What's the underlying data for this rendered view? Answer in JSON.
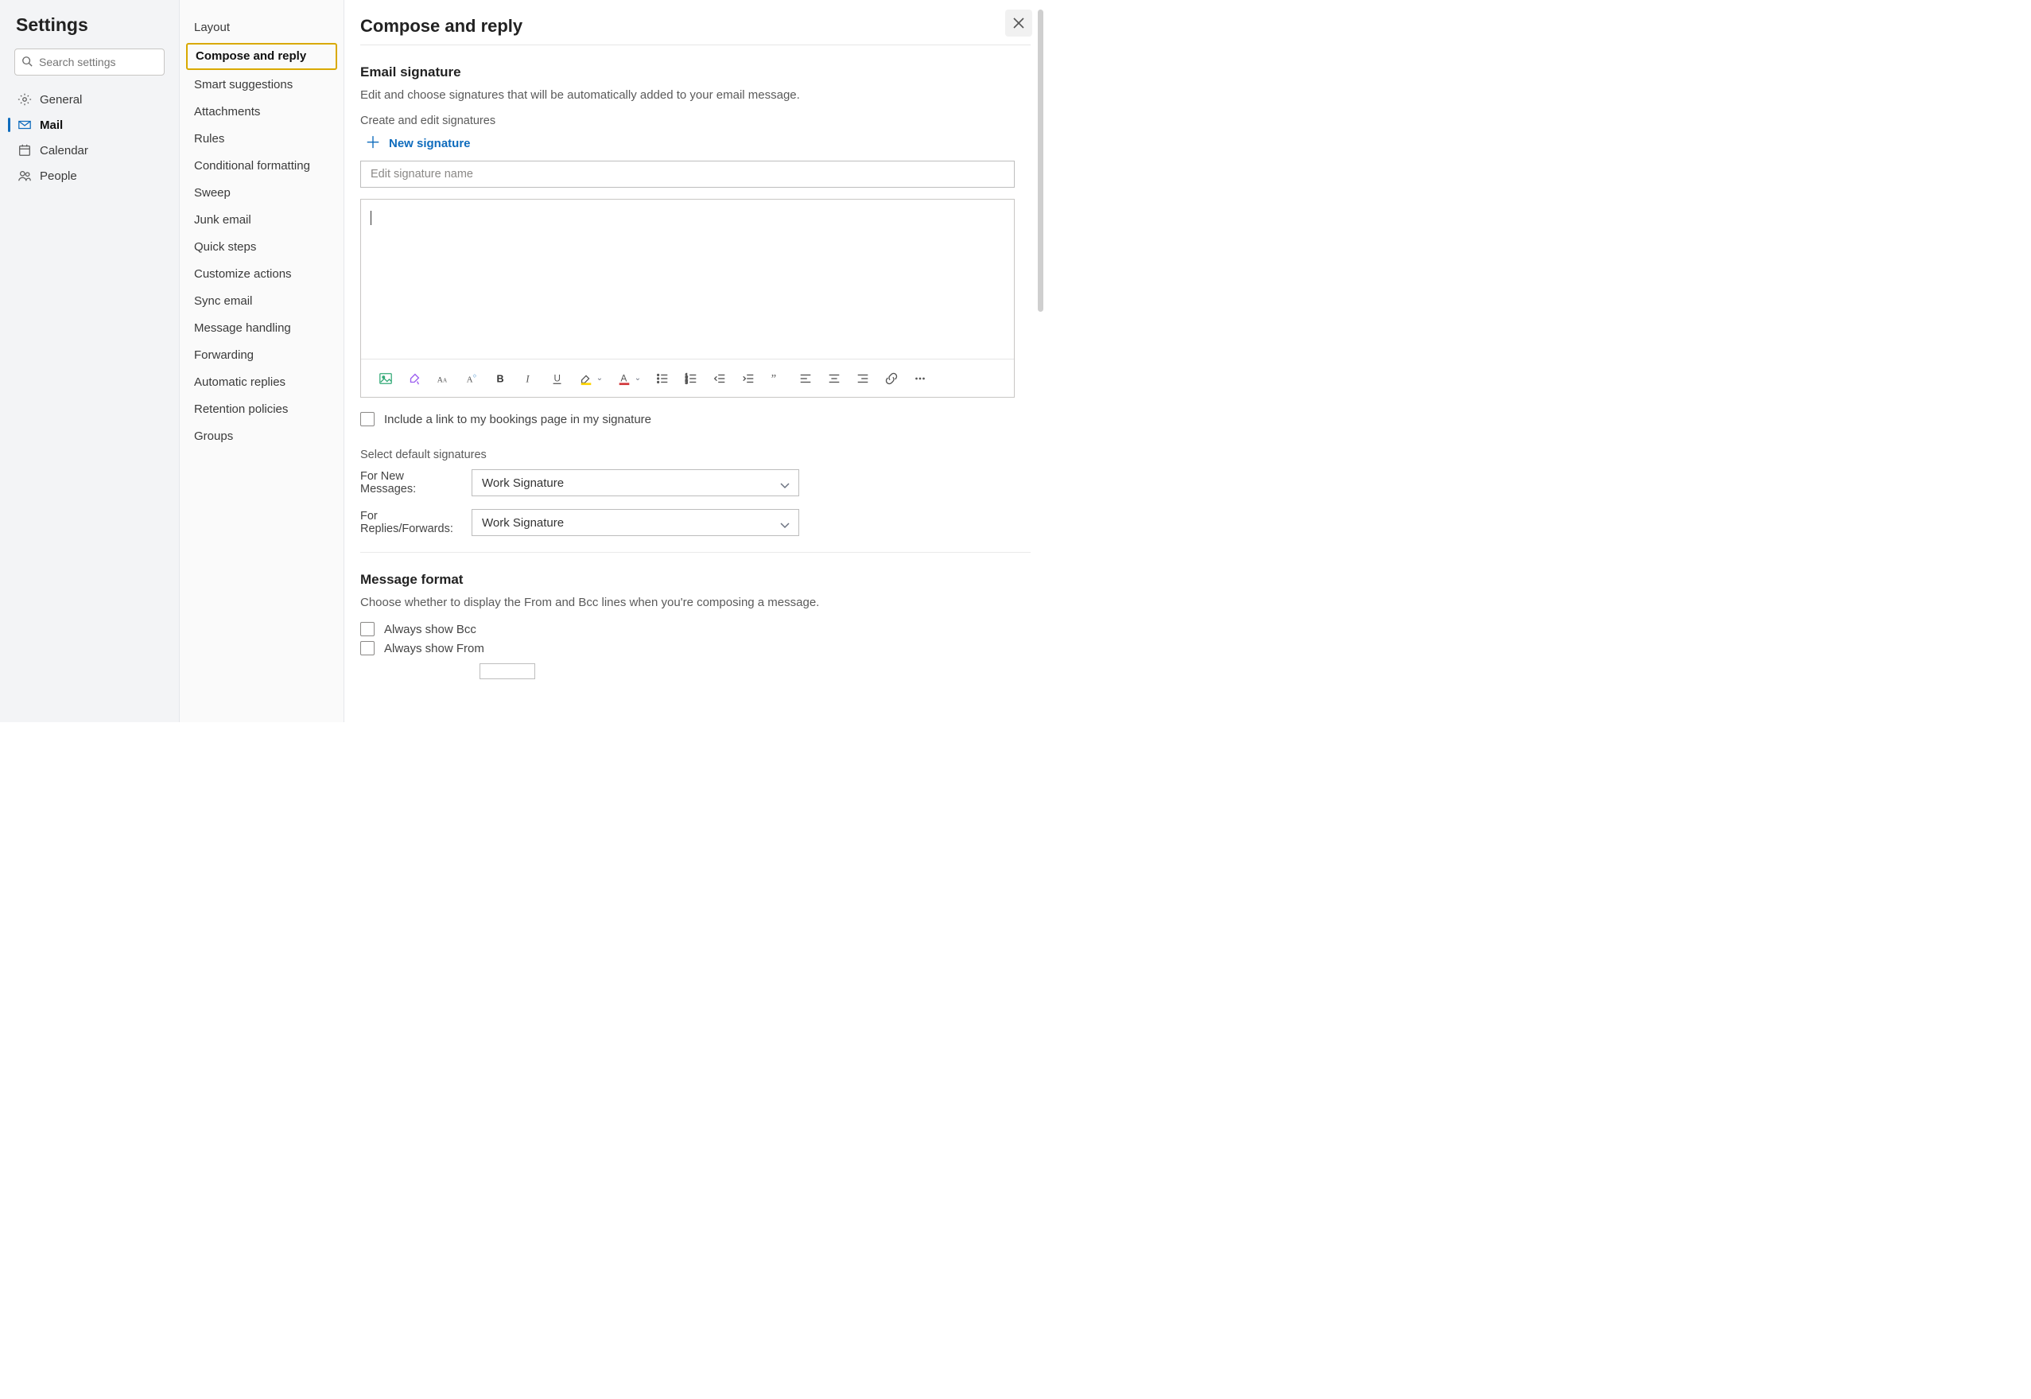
{
  "settings_title": "Settings",
  "search": {
    "placeholder": "Search settings"
  },
  "categories": [
    {
      "id": "general",
      "label": "General",
      "active": false,
      "icon": "gear"
    },
    {
      "id": "mail",
      "label": "Mail",
      "active": true,
      "icon": "mail"
    },
    {
      "id": "calendar",
      "label": "Calendar",
      "active": false,
      "icon": "calendar"
    },
    {
      "id": "people",
      "label": "People",
      "active": false,
      "icon": "people"
    }
  ],
  "subnav": [
    {
      "id": "layout",
      "label": "Layout",
      "hl": false
    },
    {
      "id": "compose-and-reply",
      "label": "Compose and reply",
      "hl": true
    },
    {
      "id": "smart-suggestions",
      "label": "Smart suggestions",
      "hl": false
    },
    {
      "id": "attachments",
      "label": "Attachments",
      "hl": false
    },
    {
      "id": "rules",
      "label": "Rules",
      "hl": false
    },
    {
      "id": "conditional-format",
      "label": "Conditional formatting",
      "hl": false
    },
    {
      "id": "sweep",
      "label": "Sweep",
      "hl": false
    },
    {
      "id": "junk-email",
      "label": "Junk email",
      "hl": false
    },
    {
      "id": "quick-steps",
      "label": "Quick steps",
      "hl": false
    },
    {
      "id": "customize-actions",
      "label": "Customize actions",
      "hl": false
    },
    {
      "id": "sync-email",
      "label": "Sync email",
      "hl": false
    },
    {
      "id": "message-handling",
      "label": "Message handling",
      "hl": false
    },
    {
      "id": "forwarding",
      "label": "Forwarding",
      "hl": false
    },
    {
      "id": "automatic-replies",
      "label": "Automatic replies",
      "hl": false
    },
    {
      "id": "retention-policies",
      "label": "Retention policies",
      "hl": false
    },
    {
      "id": "groups",
      "label": "Groups",
      "hl": false
    }
  ],
  "main": {
    "title": "Compose and reply",
    "signature": {
      "heading": "Email signature",
      "desc": "Edit and choose signatures that will be automatically added to your email message.",
      "create_label": "Create and edit signatures",
      "new_label": "New signature",
      "name_placeholder": "Edit signature name",
      "bookings_checkbox": "Include a link to my bookings page in my signature",
      "defaults_heading": "Select default signatures",
      "for_new_label": "For New Messages:",
      "for_new_value": "Work Signature",
      "for_reply_label": "For Replies/Forwards:",
      "for_reply_value": "Work Signature"
    },
    "format": {
      "heading": "Message format",
      "desc": "Choose whether to display the From and Bcc lines when you're composing a message.",
      "always_bcc": "Always show Bcc",
      "always_from": "Always show From"
    }
  },
  "toolbar_icons": [
    "insert-image",
    "paint-format",
    "font-family",
    "font-size",
    "bold",
    "italic",
    "underline",
    "highlight-color",
    "font-color",
    "bulleted-list",
    "numbered-list",
    "decrease-indent",
    "increase-indent",
    "quote",
    "align-left",
    "align-center",
    "align-right",
    "insert-link",
    "more-options"
  ]
}
